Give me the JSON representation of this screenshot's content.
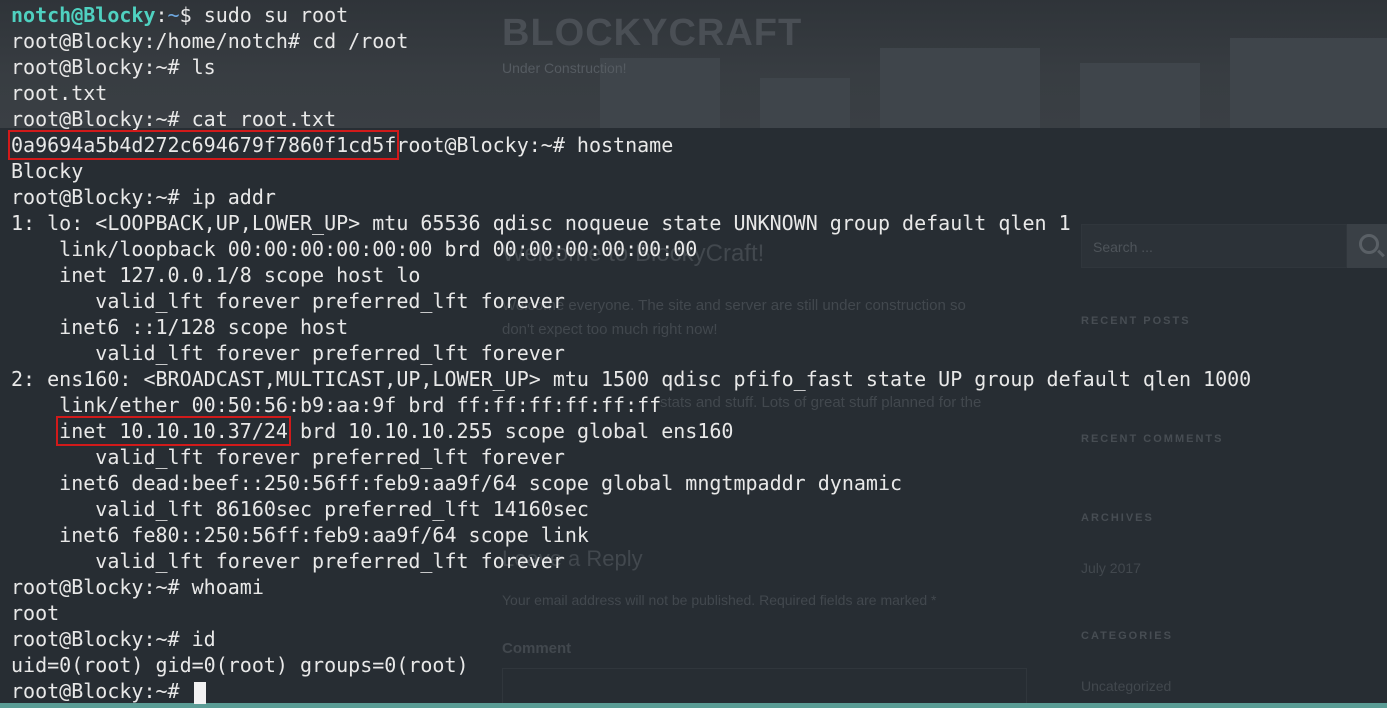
{
  "background_page": {
    "site_title": "BLOCKYCRAFT",
    "tagline": "Under Construction!",
    "post_title": "Welcome to BlockyCraft!",
    "post_line1": "Welcome everyone. The site and server are still under construction so",
    "post_line2": "don't expect too much right now!",
    "post_line3": "stats and stuff. Lots of great stuff planned for the",
    "reply_title": "Leave a Reply",
    "reply_note": "Your email address will not be published. Required fields are marked *",
    "comment_label": "Comment",
    "search_placeholder": "Search ...",
    "widgets": {
      "recent_posts": "RECENT POSTS",
      "recent_comments": "RECENT COMMENTS",
      "archives": "ARCHIVES",
      "archive_item": "July 2017",
      "categories": "CATEGORIES",
      "category_item": "Uncategorized"
    }
  },
  "terminal": {
    "user_prompt": {
      "user": "notch@Blocky",
      "sep": ":",
      "path": "~",
      "symbol": "$ ",
      "command": "sudo su root"
    },
    "lines": [
      "root@Blocky:/home/notch# cd /root",
      "root@Blocky:~# ls",
      "root.txt",
      "root@Blocky:~# cat root.txt"
    ],
    "flag": "0a9694a5b4d272c694679f7860f1cd5f",
    "flag_suffix": "root@Blocky:~# hostname",
    "lines2": [
      "Blocky",
      "root@Blocky:~# ip addr",
      "1: lo: <LOOPBACK,UP,LOWER_UP> mtu 65536 qdisc noqueue state UNKNOWN group default qlen 1",
      "    link/loopback 00:00:00:00:00:00 brd 00:00:00:00:00:00",
      "    inet 127.0.0.1/8 scope host lo",
      "       valid_lft forever preferred_lft forever",
      "    inet6 ::1/128 scope host",
      "       valid_lft forever preferred_lft forever",
      "2: ens160: <BROADCAST,MULTICAST,UP,LOWER_UP> mtu 1500 qdisc pfifo_fast state UP group default qlen 1000",
      "    link/ether 00:50:56:b9:aa:9f brd ff:ff:ff:ff:ff:ff"
    ],
    "inet_indent": "    ",
    "inet_highlight": "inet 10.10.10.37/24",
    "inet_rest": " brd 10.10.10.255 scope global ens160",
    "lines3": [
      "       valid_lft forever preferred_lft forever",
      "    inet6 dead:beef::250:56ff:feb9:aa9f/64 scope global mngtmpaddr dynamic",
      "       valid_lft 86160sec preferred_lft 14160sec",
      "    inet6 fe80::250:56ff:feb9:aa9f/64 scope link",
      "       valid_lft forever preferred_lft forever",
      "root@Blocky:~# whoami",
      "root",
      "root@Blocky:~# id",
      "uid=0(root) gid=0(root) groups=0(root)"
    ],
    "final_prompt": "root@Blocky:~# "
  },
  "colors": {
    "user_prompt": "#4fd1c0",
    "path": "#6ea8e0",
    "highlight_box": "#d11a1a",
    "text": "#e8e8e8"
  }
}
